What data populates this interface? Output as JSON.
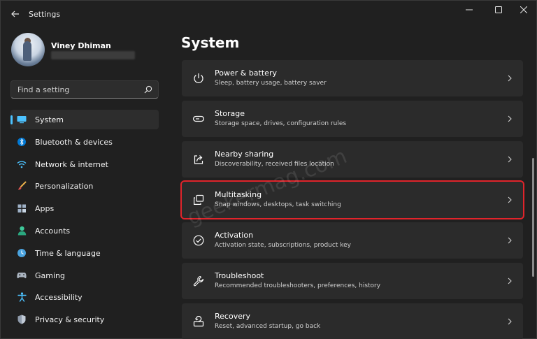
{
  "window": {
    "title": "Settings"
  },
  "profile": {
    "name": "Viney Dhiman"
  },
  "search": {
    "placeholder": "Find a setting"
  },
  "nav": {
    "items": [
      {
        "label": "System",
        "icon": "monitor-icon",
        "active": true
      },
      {
        "label": "Bluetooth & devices",
        "icon": "bluetooth-icon"
      },
      {
        "label": "Network & internet",
        "icon": "wifi-icon"
      },
      {
        "label": "Personalization",
        "icon": "brush-icon"
      },
      {
        "label": "Apps",
        "icon": "apps-grid-icon"
      },
      {
        "label": "Accounts",
        "icon": "person-icon"
      },
      {
        "label": "Time & language",
        "icon": "globe-clock-icon"
      },
      {
        "label": "Gaming",
        "icon": "gamepad-icon"
      },
      {
        "label": "Accessibility",
        "icon": "accessibility-icon"
      },
      {
        "label": "Privacy & security",
        "icon": "shield-icon"
      }
    ]
  },
  "main": {
    "title": "System",
    "cards": [
      {
        "title": "Power & battery",
        "subtitle": "Sleep, battery usage, battery saver",
        "icon": "power-icon"
      },
      {
        "title": "Storage",
        "subtitle": "Storage space, drives, configuration rules",
        "icon": "storage-icon"
      },
      {
        "title": "Nearby sharing",
        "subtitle": "Discoverability, received files location",
        "icon": "share-icon"
      },
      {
        "title": "Multitasking",
        "subtitle": "Snap windows, desktops, task switching",
        "icon": "multitasking-icon",
        "highlighted": true
      },
      {
        "title": "Activation",
        "subtitle": "Activation state, subscriptions, product key",
        "icon": "check-circle-icon"
      },
      {
        "title": "Troubleshoot",
        "subtitle": "Recommended troubleshooters, preferences, history",
        "icon": "wrench-icon"
      },
      {
        "title": "Recovery",
        "subtitle": "Reset, advanced startup, go back",
        "icon": "recovery-icon"
      }
    ]
  },
  "watermark": "geekermag.com",
  "colors": {
    "background": "#202020",
    "card": "#2b2b2b",
    "accent": "#4cc2ff",
    "highlight": "#e0242b"
  }
}
